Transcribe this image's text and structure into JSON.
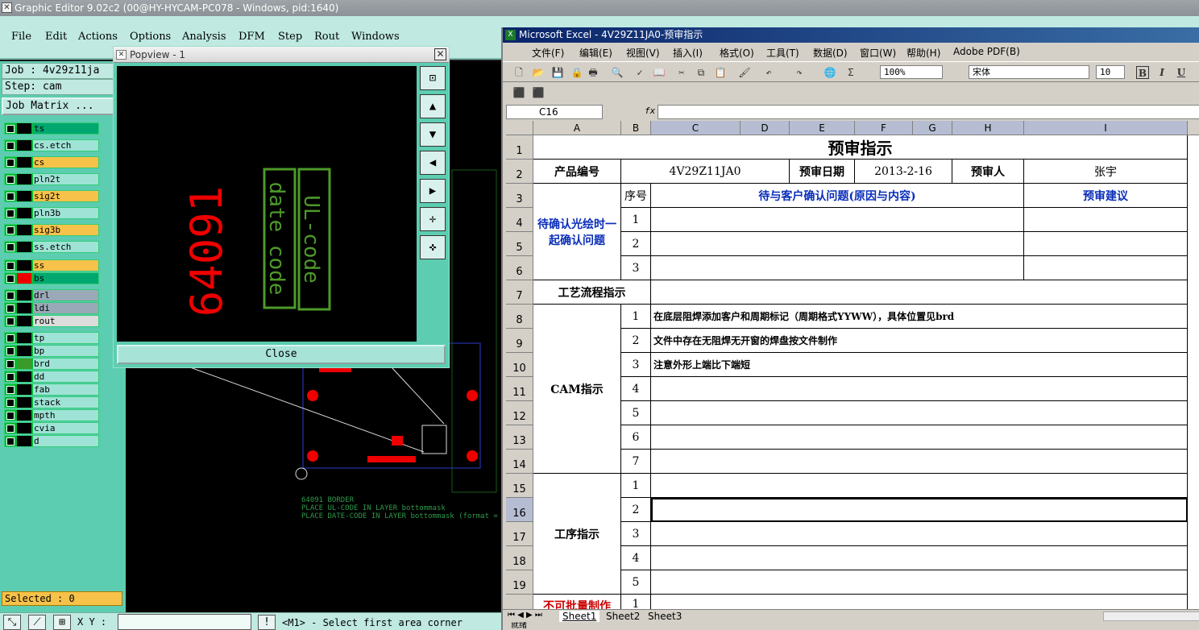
{
  "genesis": {
    "window_title": "Graphic Editor 9.02c2 (00@HY-HYCAM-PC078 - Windows, pid:1640)",
    "menu": [
      "File",
      "Edit",
      "Actions",
      "Options",
      "Analysis",
      "DFM",
      "Step",
      "Rout",
      "Windows"
    ],
    "job_label": "Job : 4v29z11ja",
    "step_label": "Step: cam",
    "job_matrix_button": "Job Matrix ...",
    "layers": [
      {
        "name": "ts",
        "color": "#00a870"
      },
      {
        "name": "cs.etch",
        "color": "#9fe3d6"
      },
      {
        "name": "cs",
        "color": "#f6c24a"
      },
      {
        "name": "pln2t",
        "color": "#9fe3d6"
      },
      {
        "name": "sig2t",
        "color": "#f6c24a"
      },
      {
        "name": "pln3b",
        "color": "#9fe3d6"
      },
      {
        "name": "sig3b",
        "color": "#f6c24a"
      },
      {
        "name": "ss.etch",
        "color": "#9fe3d6"
      },
      {
        "name": "ss",
        "color": "#f6c24a"
      },
      {
        "name": "bs",
        "color": "#00a870"
      },
      {
        "name": "drl",
        "color": "#9aa9b8"
      },
      {
        "name": "ldi",
        "color": "#9aa9b8"
      },
      {
        "name": "rout",
        "color": "#dcdcdc"
      },
      {
        "name": "tp",
        "color": "#9fe3d6"
      },
      {
        "name": "bp",
        "color": "#9fe3d6"
      },
      {
        "name": "brd",
        "color": "#9fe3d6"
      },
      {
        "name": "dd",
        "color": "#9fe3d6"
      },
      {
        "name": "fab",
        "color": "#9fe3d6"
      },
      {
        "name": "stack",
        "color": "#9fe3d6"
      },
      {
        "name": "mpth",
        "color": "#9fe3d6"
      },
      {
        "name": "cvia",
        "color": "#9fe3d6"
      },
      {
        "name": "d",
        "color": "#9fe3d6"
      }
    ],
    "selected_label": "Selected : 0",
    "xy_label": "X Y :",
    "status_message": "<M1> - Select first area corner",
    "canvas_notes": [
      "64091   BORDER",
      "PLACE UL-CODE IN LAYER bottommask",
      "PLACE DATE-CODE IN LAYER bottommask (format = YYWW"
    ]
  },
  "popview": {
    "title": "Popview - 1",
    "close_label": "Close",
    "text_red": "64091",
    "text_box1": "date code",
    "text_box2": "UL-code"
  },
  "excel": {
    "window_title": "Microsoft Excel - 4V29Z11JA0-预审指示",
    "menu": [
      "文件(F)",
      "编辑(E)",
      "视图(V)",
      "插入(I)",
      "格式(O)",
      "工具(T)",
      "数据(D)",
      "窗口(W)",
      "帮助(H)",
      "Adobe PDF(B)"
    ],
    "zoom": "100%",
    "font_name": "宋体",
    "font_size": "10",
    "bold": "B",
    "italic": "I",
    "underline": "U",
    "name_box": "C16",
    "fx": "fx",
    "columns": [
      "A",
      "B",
      "C",
      "D",
      "E",
      "F",
      "G",
      "H",
      "I"
    ],
    "rows": [
      "1",
      "2",
      "3",
      "4",
      "5",
      "6",
      "7",
      "8",
      "9",
      "10",
      "11",
      "12",
      "13",
      "14",
      "15",
      "16",
      "17",
      "18",
      "19"
    ],
    "title": "预审指示",
    "product_no_label": "产品编号",
    "product_no": "4V29Z11JA0",
    "review_date_label": "预审日期",
    "review_date": "2013-2-16",
    "reviewer_label": "预审人",
    "reviewer": "张宇",
    "confirm_section": "待确认光绘时一起确认问题",
    "seq_header": "序号",
    "issue_header": "待与客户确认问题(原因与内容)",
    "suggest_header": "预审建议",
    "process_flow": "工艺流程指示",
    "cam_section": "CAM指示",
    "cam_items": [
      "在底层阻焊添加客户和周期标记（周期格式YYWW），具体位置见brd",
      "文件中存在无阻焊无开窗的焊盘按文件制作",
      "注意外形上端比下端短",
      "",
      "",
      "",
      ""
    ],
    "process_section": "工序指示",
    "nums3": [
      "1",
      "2",
      "3"
    ],
    "nums7": [
      "1",
      "2",
      "3",
      "4",
      "5",
      "6",
      "7"
    ],
    "nums5": [
      "1",
      "2",
      "3",
      "4",
      "5"
    ],
    "partial_row_label": "不可批量制作",
    "partial_row_num": "1",
    "sheets": [
      "Sheet1",
      "Sheet2",
      "Sheet3"
    ],
    "status": "就绪"
  }
}
